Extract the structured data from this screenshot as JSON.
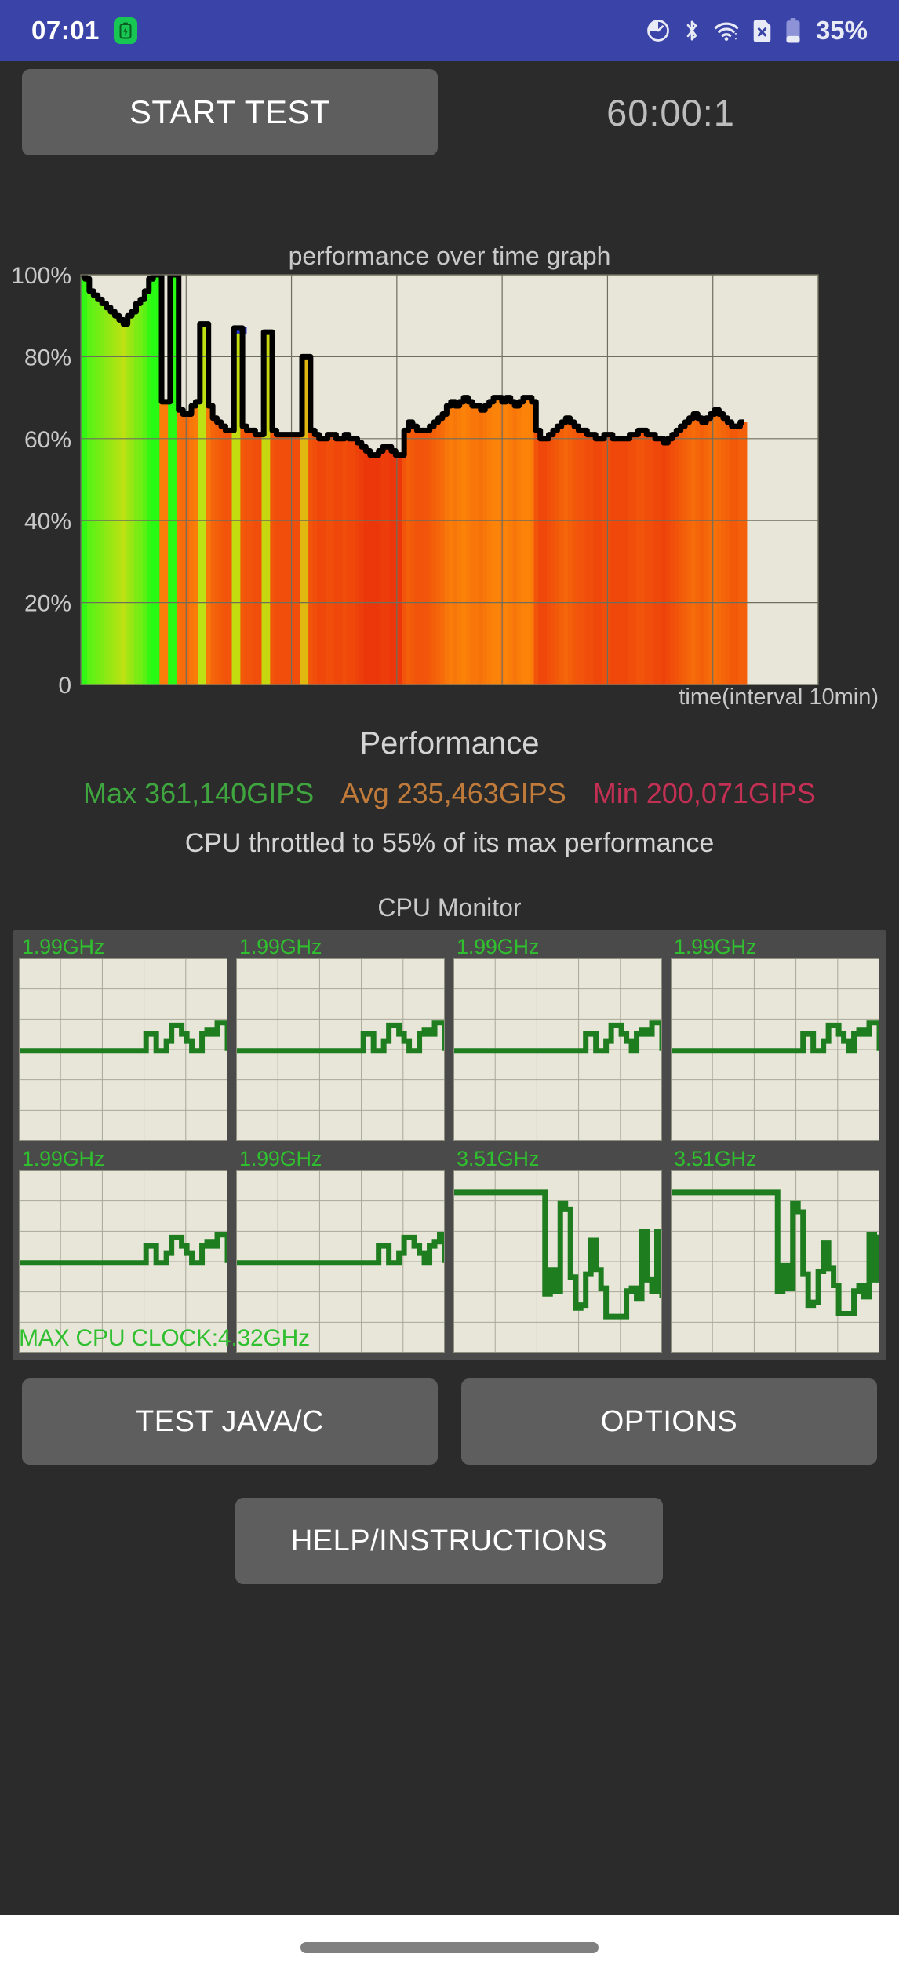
{
  "status_bar": {
    "clock": "07:01",
    "battery_percent": "35%",
    "icons": [
      "battery-saver-chip-icon",
      "speedometer-icon",
      "bluetooth-icon",
      "wifi-icon",
      "sim-card-off-icon",
      "battery-icon"
    ],
    "background_color": "#3a43a8"
  },
  "header": {
    "start_test_label": "START TEST",
    "timer": "60:00:1"
  },
  "chart_data": {
    "type": "area",
    "title": "performance over time graph",
    "xlabel": "time(interval 10min)",
    "ylabel": "",
    "ylim": [
      0,
      100
    ],
    "ytick_labels": [
      "100%",
      "80%",
      "60%",
      "40%",
      "20%",
      "0"
    ],
    "ytick_values": [
      100,
      80,
      60,
      40,
      20,
      0
    ],
    "x_gridlines": 7,
    "grid": true,
    "plot_background": "#e8e6d8",
    "line_color": "#000000",
    "data_end_fraction": 0.9,
    "series_name": "performance",
    "x": [
      0,
      0.6,
      1.2,
      1.8,
      2.4,
      3,
      3.6,
      4.2,
      4.8,
      5.4,
      6,
      6.6,
      7.2,
      7.8,
      8.4,
      9,
      9.6,
      10.2,
      10.8,
      11.4,
      12,
      12.6,
      13.2,
      13.8,
      14.4,
      15,
      15.6,
      16.2,
      16.8,
      17.4,
      18,
      18.6,
      19.2,
      19.8,
      20.4,
      21,
      21.6,
      22.2,
      22.8,
      23.4,
      24,
      24.6,
      25.2,
      25.8,
      26.4,
      27,
      27.6,
      28.2,
      28.8,
      29.4,
      30,
      30.6,
      31.2,
      31.8,
      32.4,
      33,
      33.6,
      34.2,
      34.8,
      35.4,
      36,
      36.6,
      37.2,
      37.8,
      38.4,
      39,
      39.6,
      40.2,
      40.8,
      41.4,
      42,
      42.6,
      43.2,
      43.8,
      44.4,
      45,
      45.6,
      46.2,
      46.8,
      47.4,
      48,
      48.6,
      49.2,
      49.8,
      50.4,
      51,
      51.6,
      52.2,
      52.8,
      53.4,
      54,
      54.6,
      55.2,
      55.8,
      56.4,
      57,
      57.6,
      58.2,
      58.8,
      59.4,
      60,
      60.6,
      61.2,
      61.8,
      62.4,
      63,
      63.6,
      64.2,
      64.8,
      65.4,
      66,
      66.6,
      67.2,
      67.8,
      68.4,
      69,
      69.6,
      70.2,
      70.8,
      71.4,
      72,
      72.6,
      73.2,
      73.8,
      74.4,
      75,
      75.6,
      76.2,
      76.8,
      77.4,
      78,
      78.6,
      79.2,
      79.8,
      80.4,
      81,
      81.6,
      82.2,
      82.8,
      83.4,
      84,
      84.6,
      85.2,
      85.8,
      86.4,
      87,
      87.6,
      88.2,
      88.8,
      89.4,
      90
    ],
    "values": [
      100,
      99,
      96,
      95,
      94,
      93,
      92,
      91,
      90,
      89,
      88,
      90,
      91,
      93,
      94,
      96,
      99,
      100,
      100,
      69,
      69,
      100,
      100,
      67,
      66,
      66,
      68,
      69,
      88,
      88,
      68,
      65,
      64,
      63,
      62,
      62,
      87,
      87,
      63,
      62,
      62,
      61,
      61,
      86,
      86,
      62,
      61,
      61,
      61,
      61,
      61,
      61,
      80,
      80,
      62,
      61,
      60,
      60,
      61,
      61,
      60,
      60,
      61,
      60,
      60,
      59,
      58,
      57,
      56,
      56,
      57,
      58,
      58,
      57,
      56,
      56,
      62,
      64,
      63,
      62,
      62,
      62,
      63,
      64,
      65,
      66,
      68,
      69,
      68,
      69,
      70,
      69,
      68,
      68,
      67,
      68,
      69,
      70,
      70,
      69,
      70,
      69,
      68,
      69,
      70,
      70,
      69,
      62,
      60,
      60,
      61,
      62,
      63,
      64,
      65,
      64,
      63,
      62,
      62,
      61,
      61,
      60,
      60,
      61,
      61,
      60,
      60,
      60,
      60,
      61,
      61,
      62,
      62,
      61,
      61,
      60,
      60,
      59,
      60,
      61,
      62,
      63,
      64,
      65,
      66,
      65,
      64,
      65,
      66,
      67,
      66,
      65,
      64,
      63,
      63,
      64,
      64
    ],
    "min_marker": {
      "color": "#2b3ad0",
      "position_fraction": 0.24,
      "label": "minimum-dip"
    },
    "fill_bands": "vertical color bands ranging green (high) through yellow, orange, to red (low) representing per-sample performance level"
  },
  "performance": {
    "title": "Performance",
    "max_label": "Max 361,140GIPS",
    "avg_label": "Avg 235,463GIPS",
    "min_label": "Min 200,071GIPS",
    "max_color": "#3fa63f",
    "avg_color": "#c07b3a",
    "min_color": "#c33054",
    "throttle_text": "CPU throttled to 55% of its max performance"
  },
  "cpu_monitor": {
    "title": "CPU Monitor",
    "max_clock_label": "MAX CPU CLOCK:4.32GHz",
    "accent_color": "#2fbf2f",
    "panel_background": "#4a4a4a",
    "mini_plot_background": "#e8e6d8",
    "cores": [
      {
        "freq": "1.99GHz",
        "baseline": 0.5,
        "samples": [
          0.5,
          0.5,
          0.5,
          0.5,
          0.5,
          0.5,
          0.5,
          0.5,
          0.5,
          0.5,
          0.5,
          0.5,
          0.5,
          0.5,
          0.5,
          0.5,
          0.5,
          0.5,
          0.5,
          0.5,
          0.5,
          0.5,
          0.5,
          0.5,
          0.5,
          0.62,
          0.62,
          0.5,
          0.5,
          0.57,
          0.68,
          0.68,
          0.62,
          0.57,
          0.5,
          0.5,
          0.62,
          0.65,
          0.62,
          0.7,
          0.7,
          0.5
        ]
      },
      {
        "freq": "1.99GHz",
        "baseline": 0.5,
        "samples": [
          0.5,
          0.5,
          0.5,
          0.5,
          0.5,
          0.5,
          0.5,
          0.5,
          0.5,
          0.5,
          0.5,
          0.5,
          0.5,
          0.5,
          0.5,
          0.5,
          0.5,
          0.5,
          0.5,
          0.5,
          0.5,
          0.5,
          0.5,
          0.5,
          0.5,
          0.62,
          0.62,
          0.5,
          0.5,
          0.57,
          0.68,
          0.68,
          0.62,
          0.57,
          0.5,
          0.5,
          0.62,
          0.65,
          0.62,
          0.7,
          0.7,
          0.5
        ]
      },
      {
        "freq": "1.99GHz",
        "baseline": 0.5,
        "samples": [
          0.5,
          0.5,
          0.5,
          0.5,
          0.5,
          0.5,
          0.5,
          0.5,
          0.5,
          0.5,
          0.5,
          0.5,
          0.5,
          0.5,
          0.5,
          0.5,
          0.5,
          0.5,
          0.5,
          0.5,
          0.5,
          0.5,
          0.5,
          0.5,
          0.5,
          0.5,
          0.62,
          0.62,
          0.5,
          0.5,
          0.57,
          0.68,
          0.68,
          0.62,
          0.57,
          0.5,
          0.62,
          0.65,
          0.62,
          0.7,
          0.7,
          0.5
        ]
      },
      {
        "freq": "1.99GHz",
        "baseline": 0.5,
        "samples": [
          0.5,
          0.5,
          0.5,
          0.5,
          0.5,
          0.5,
          0.5,
          0.5,
          0.5,
          0.5,
          0.5,
          0.5,
          0.5,
          0.5,
          0.5,
          0.5,
          0.5,
          0.5,
          0.5,
          0.5,
          0.5,
          0.5,
          0.5,
          0.5,
          0.5,
          0.5,
          0.62,
          0.62,
          0.5,
          0.5,
          0.57,
          0.68,
          0.68,
          0.62,
          0.57,
          0.5,
          0.62,
          0.65,
          0.62,
          0.7,
          0.7,
          0.5
        ]
      },
      {
        "freq": "1.99GHz",
        "baseline": 0.5,
        "samples": [
          0.5,
          0.5,
          0.5,
          0.5,
          0.5,
          0.5,
          0.5,
          0.5,
          0.5,
          0.5,
          0.5,
          0.5,
          0.5,
          0.5,
          0.5,
          0.5,
          0.5,
          0.5,
          0.5,
          0.5,
          0.5,
          0.5,
          0.5,
          0.5,
          0.5,
          0.62,
          0.62,
          0.5,
          0.5,
          0.57,
          0.68,
          0.68,
          0.62,
          0.57,
          0.5,
          0.5,
          0.62,
          0.65,
          0.62,
          0.7,
          0.7,
          0.5
        ]
      },
      {
        "freq": "1.99GHz",
        "baseline": 0.5,
        "samples": [
          0.5,
          0.5,
          0.5,
          0.5,
          0.5,
          0.5,
          0.5,
          0.5,
          0.5,
          0.5,
          0.5,
          0.5,
          0.5,
          0.5,
          0.5,
          0.5,
          0.5,
          0.5,
          0.5,
          0.5,
          0.5,
          0.5,
          0.5,
          0.5,
          0.5,
          0.5,
          0.5,
          0.5,
          0.62,
          0.62,
          0.5,
          0.5,
          0.57,
          0.68,
          0.68,
          0.62,
          0.57,
          0.5,
          0.62,
          0.65,
          0.7,
          0.5
        ]
      },
      {
        "freq": "3.51GHz",
        "baseline": 1.0,
        "samples": [
          1.0,
          1.0,
          1.0,
          1.0,
          1.0,
          1.0,
          1.0,
          1.0,
          1.0,
          1.0,
          1.0,
          1.0,
          1.0,
          1.0,
          1.0,
          1.0,
          1.0,
          1.0,
          0.28,
          0.45,
          0.3,
          0.92,
          0.88,
          0.4,
          0.18,
          0.2,
          0.42,
          0.66,
          0.45,
          0.32,
          0.12,
          0.12,
          0.12,
          0.12,
          0.3,
          0.32,
          0.25,
          0.72,
          0.38,
          0.3,
          0.72,
          0.25
        ]
      },
      {
        "freq": "3.51GHz",
        "baseline": 1.0,
        "samples": [
          1.0,
          1.0,
          1.0,
          1.0,
          1.0,
          1.0,
          1.0,
          1.0,
          1.0,
          1.0,
          1.0,
          1.0,
          1.0,
          1.0,
          1.0,
          1.0,
          1.0,
          1.0,
          1.0,
          1.0,
          1.0,
          0.3,
          0.48,
          0.32,
          0.92,
          0.86,
          0.42,
          0.2,
          0.22,
          0.44,
          0.64,
          0.46,
          0.34,
          0.14,
          0.14,
          0.14,
          0.3,
          0.34,
          0.26,
          0.7,
          0.38,
          0.7
        ]
      }
    ],
    "mini_grid_cols": 5,
    "mini_grid_rows": 6
  },
  "bottom_buttons": {
    "test_java_c": "TEST JAVA/C",
    "options": "OPTIONS",
    "help_instructions": "HELP/INSTRUCTIONS"
  }
}
